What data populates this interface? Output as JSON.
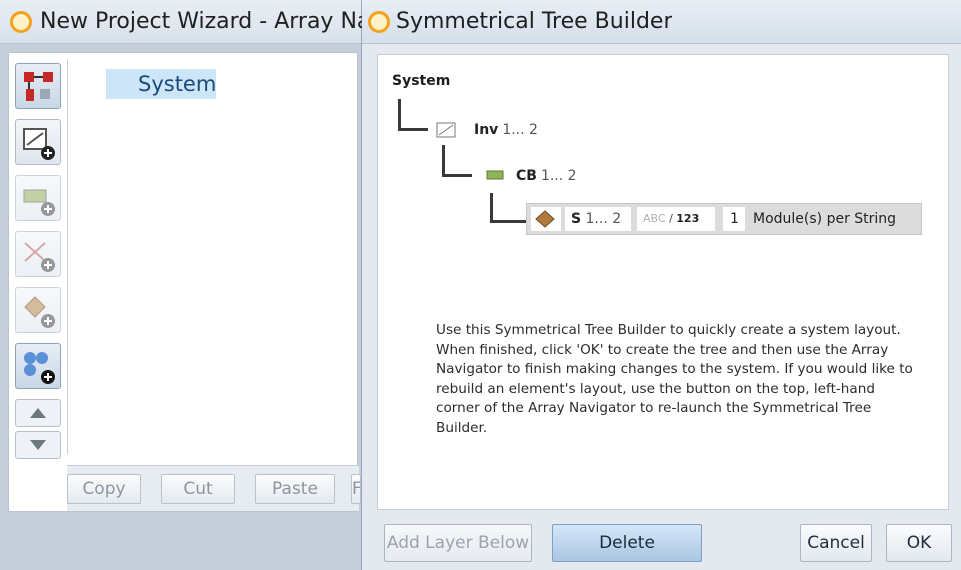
{
  "back_window": {
    "title": "New Project Wizard - Array Na",
    "tree_root": "System",
    "footer_buttons": [
      "Copy",
      "Cut",
      "Paste",
      "F"
    ]
  },
  "toolbar": {
    "buttons": [
      {
        "icon": "array-navigator-icon",
        "state": "active"
      },
      {
        "icon": "add-inverter-icon",
        "state": "normal"
      },
      {
        "icon": "add-combiner-box-icon",
        "state": "disabled"
      },
      {
        "icon": "add-string-icon",
        "state": "disabled"
      },
      {
        "icon": "add-module-icon",
        "state": "disabled"
      },
      {
        "icon": "add-group-icon",
        "state": "normal"
      }
    ],
    "arrows": [
      "move-up-icon",
      "move-down-icon"
    ]
  },
  "dialog": {
    "title": "Symmetrical Tree Builder",
    "root_label": "System",
    "nodes": [
      {
        "name": "Inv",
        "range": "1... 2",
        "icon": "inverter-icon"
      },
      {
        "name": "CB",
        "range": "1... 2",
        "icon": "combiner-box-icon"
      }
    ],
    "string_row": {
      "icon": "module-icon",
      "name": "S",
      "range": "1... 2",
      "label_mode": {
        "abc": "ABC",
        "separator": "/",
        "num": "123"
      },
      "modules_value": "1",
      "modules_label": "Module(s) per String"
    },
    "info_text": "Use this Symmetrical Tree Builder to quickly create a system layout. When finished, click 'OK' to create the tree and then use the Array Navigator to finish making changes to the system. If you would like to rebuild an element's layout, use the button on the top, left-hand corner of the Array Navigator to re-launch the Symmetrical Tree Builder.",
    "buttons": {
      "add_layer": "Add Layer Below",
      "delete": "Delete",
      "cancel": "Cancel",
      "ok": "OK"
    }
  },
  "colors": {
    "accent": "#f2a21b",
    "selection": "#cde6f7",
    "primary_button": "#a9c6e4"
  }
}
